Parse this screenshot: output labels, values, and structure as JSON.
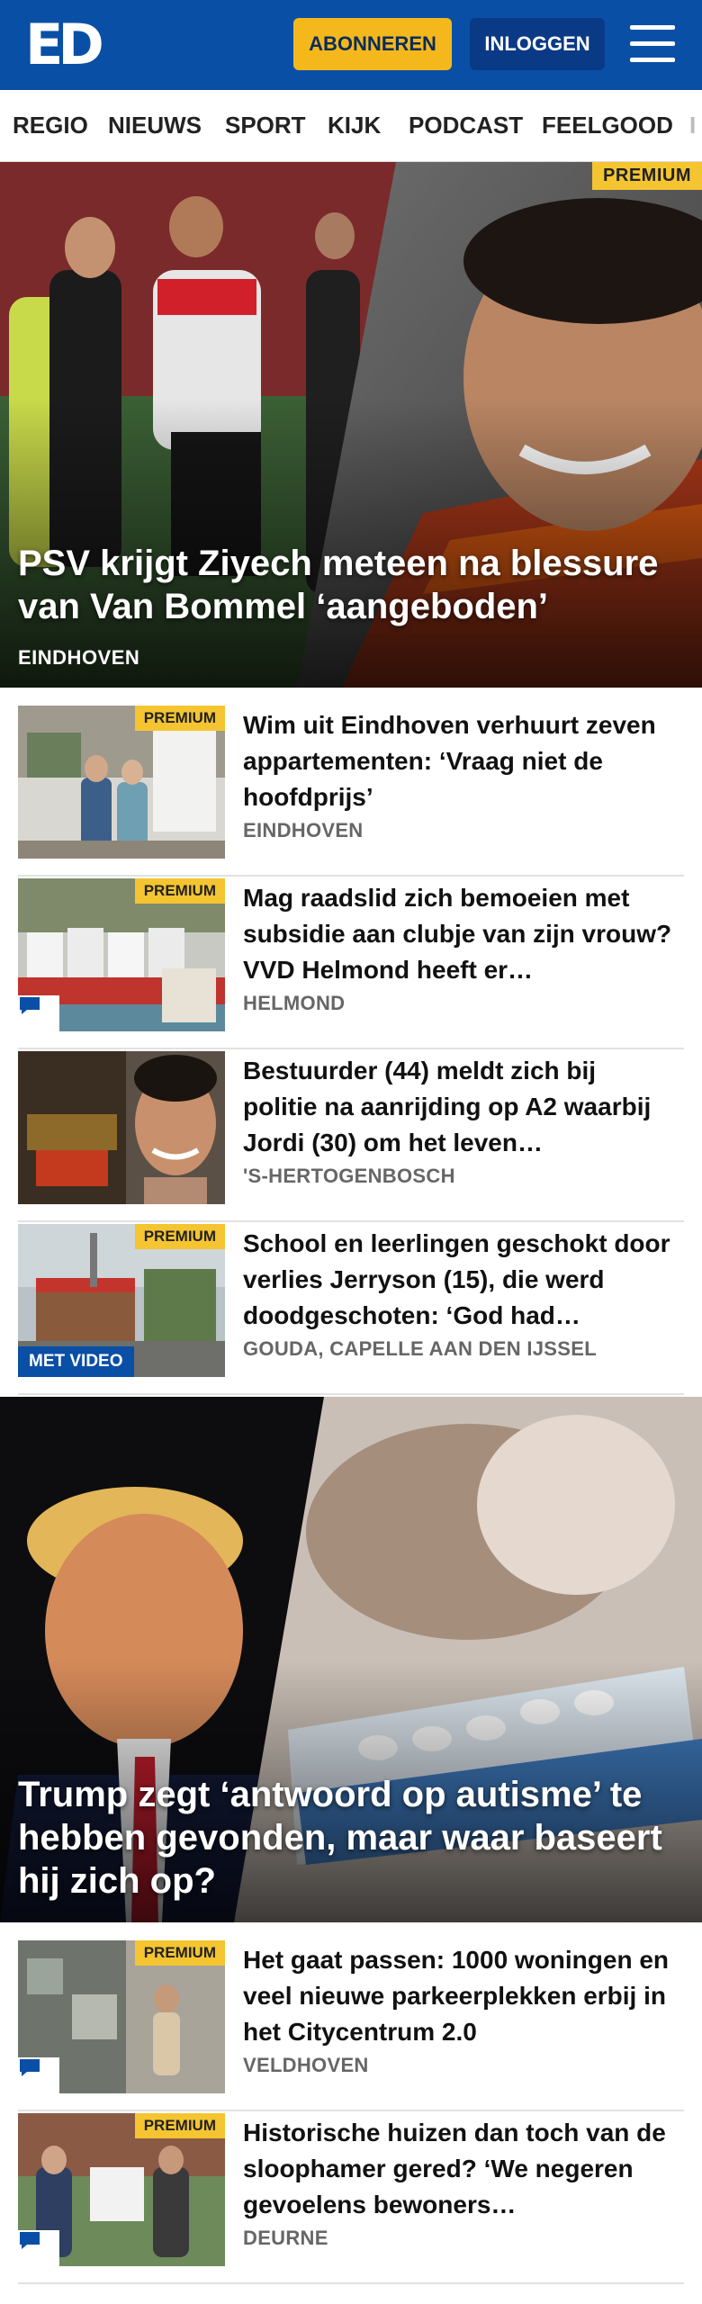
{
  "header": {
    "logo": "ED",
    "subscribe_label": "ABONNEREN",
    "login_label": "INLOGGEN",
    "brand_color": "#0a4fa6",
    "accent_color": "#f4b81c"
  },
  "nav": {
    "items": [
      "REGIO",
      "NIEUWS",
      "SPORT",
      "KIJK",
      "PODCAST",
      "FEELGOOD",
      "I"
    ]
  },
  "hero1": {
    "premium": "PREMIUM",
    "title": "PSV krijgt Ziyech meteen na blessure van Van Bommel ‘aangeboden’",
    "region": "EINDHOVEN"
  },
  "articles1": [
    {
      "title": "Wim uit Eindhoven verhuurt zeven appartementen: ‘Vraag niet de hoofdprijs’",
      "region": "EINDHOVEN",
      "premium": "PREMIUM",
      "comment": false,
      "video": ""
    },
    {
      "title": "Mag raadslid zich bemoeien met subsidie aan clubje van zijn vrouw? VVD Helmond heeft er…",
      "region": "HELMOND",
      "premium": "PREMIUM",
      "comment": true,
      "video": ""
    },
    {
      "title": "Bestuurder (44) meldt zich bij politie na aanrijding op A2 waarbij Jordi (30) om het leven…",
      "region": "'S-HERTOGENBOSCH",
      "premium": "",
      "comment": false,
      "video": ""
    },
    {
      "title": "School en leerlingen geschokt door verlies Jerryson (15), die werd doodgeschoten: ‘God had…",
      "region": "GOUDA, CAPELLE AAN DEN IJSSEL",
      "premium": "PREMIUM",
      "comment": false,
      "video": "MET VIDEO"
    }
  ],
  "hero2": {
    "title": "Trump zegt ‘antwoord op autisme’ te hebben gevonden, maar waar baseert hij zich op?"
  },
  "articles2": [
    {
      "title": "Het gaat passen: 1000 woningen en veel nieuwe parkeerplekken erbij in het Citycentrum 2.0",
      "region": "VELDHOVEN",
      "premium": "PREMIUM",
      "comment": true,
      "video": ""
    },
    {
      "title": "Historische huizen dan toch van de sloophamer gered? ‘We negeren gevoelens bewoners…",
      "region": "DEURNE",
      "premium": "PREMIUM",
      "comment": true,
      "video": ""
    }
  ]
}
